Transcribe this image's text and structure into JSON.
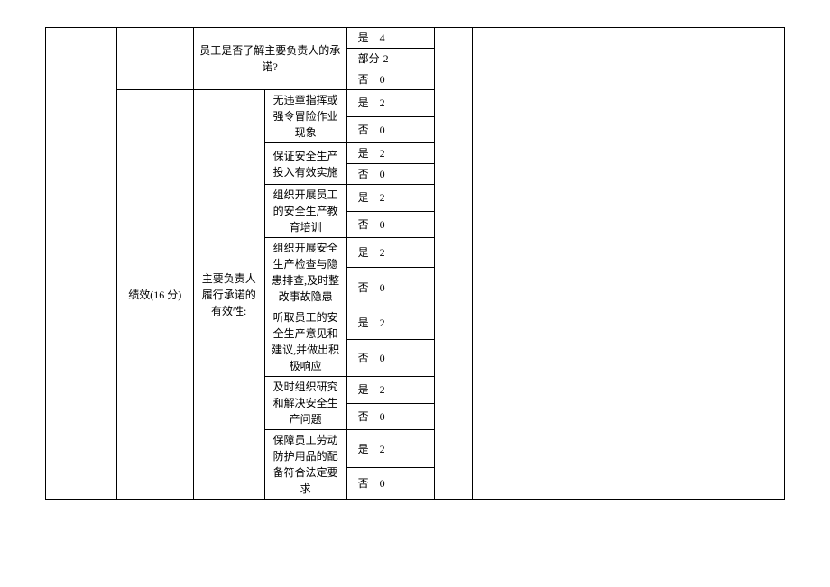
{
  "section": {
    "category_label": "绩效(16 分)",
    "sub_label": "主要负责人履行承诺的有效性:",
    "top_question": "员工是否了解主要负责人的承诺?",
    "top_options": [
      {
        "label": "是",
        "value": "4"
      },
      {
        "label": "部分",
        "value": "2"
      },
      {
        "label": "否",
        "value": "0"
      }
    ],
    "items": [
      {
        "text": "无违章指挥或强令冒险作业现象",
        "options": [
          {
            "label": "是",
            "value": "2"
          },
          {
            "label": "否",
            "value": "0"
          }
        ]
      },
      {
        "text": "保证安全生产投入有效实施",
        "options": [
          {
            "label": "是",
            "value": "2"
          },
          {
            "label": "否",
            "value": "0"
          }
        ]
      },
      {
        "text": "组织开展员工的安全生产教育培训",
        "options": [
          {
            "label": "是",
            "value": "2"
          },
          {
            "label": "否",
            "value": "0"
          }
        ]
      },
      {
        "text": "组织开展安全生产检查与隐患排查,及时整改事故隐患",
        "options": [
          {
            "label": "是",
            "value": "2"
          },
          {
            "label": "否",
            "value": "0"
          }
        ]
      },
      {
        "text": "听取员工的安全生产意见和建议,并做出积极响应",
        "options": [
          {
            "label": "是",
            "value": "2"
          },
          {
            "label": "否",
            "value": "0"
          }
        ]
      },
      {
        "text": "及时组织研究和解决安全生产问题",
        "options": [
          {
            "label": "是",
            "value": "2"
          },
          {
            "label": "否",
            "value": "0"
          }
        ]
      },
      {
        "text": "保障员工劳动防护用品的配备符合法定要求",
        "options": [
          {
            "label": "是",
            "value": "2"
          },
          {
            "label": "否",
            "value": "0"
          }
        ]
      }
    ]
  }
}
